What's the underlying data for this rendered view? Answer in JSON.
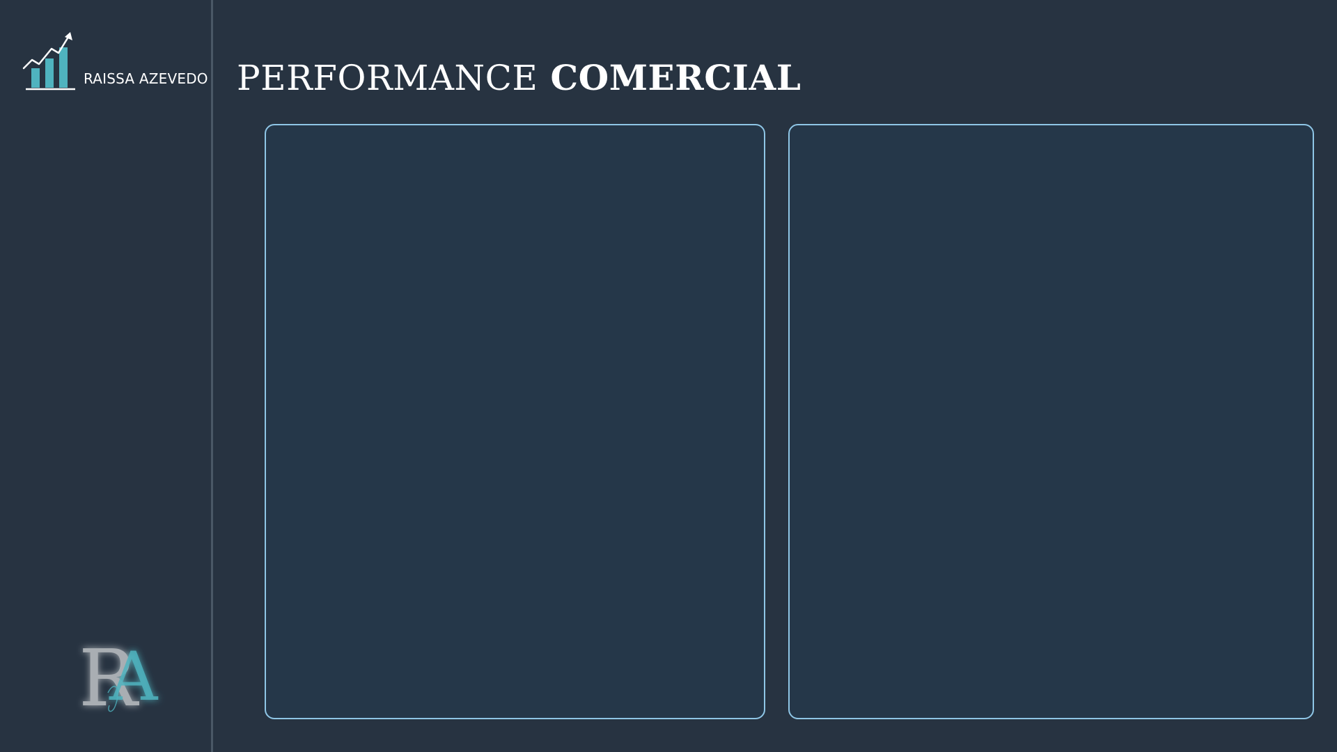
{
  "sidebar": {
    "brand_name": "RAISSA AZEVEDO",
    "brand_icon": "growth-chart-icon",
    "monogram_icon": "ra-monogram-logo",
    "monogram_text": "RA"
  },
  "header": {
    "title_light": "PERFORMANCE",
    "title_bold": "COMERCIAL"
  },
  "panels": {
    "left": {},
    "right": {}
  },
  "colors": {
    "background": "#273341",
    "panel_fill": "#253749",
    "panel_border": "#8fc6e6",
    "accent_teal": "#4fb3bf",
    "text": "#ffffff",
    "divider": "#4a5866"
  }
}
